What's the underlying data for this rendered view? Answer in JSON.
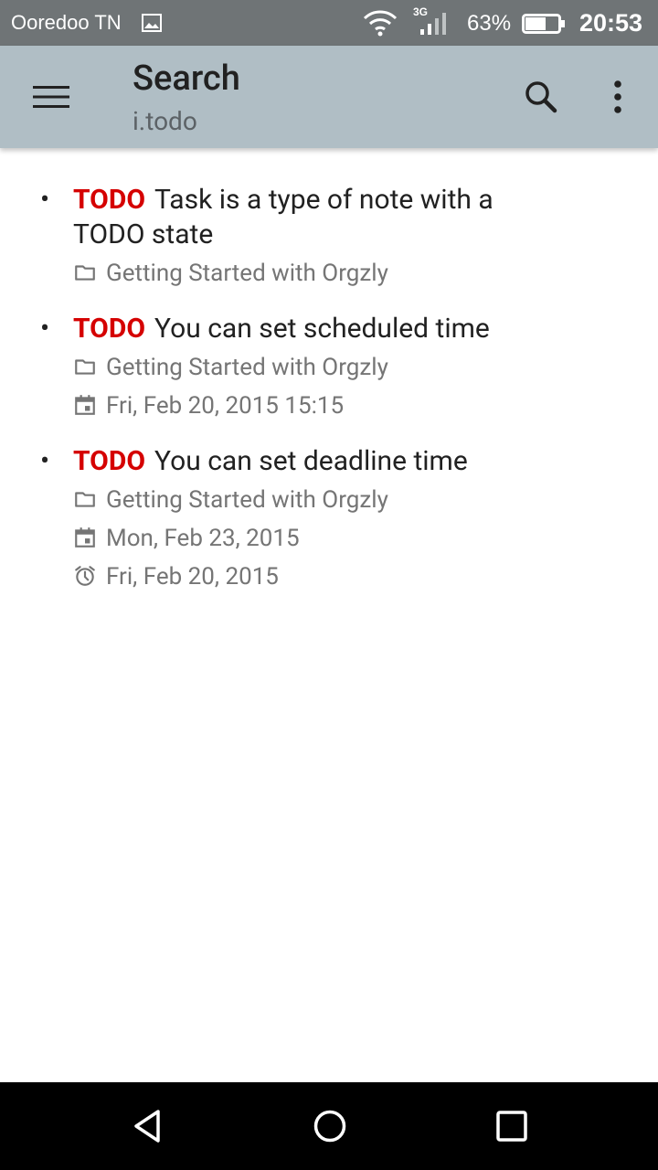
{
  "status_bar": {
    "carrier": "Ooredoo TN",
    "network_type": "3G",
    "battery_percent": "63%",
    "battery_level": 0.63,
    "time": "20:53"
  },
  "app_bar": {
    "title": "Search",
    "subtitle": "i.todo",
    "icons": [
      "menu-icon",
      "search-icon",
      "more-vert-icon"
    ]
  },
  "notes": [
    {
      "state": "TODO",
      "title": "Task is a type of note with a TODO state",
      "book": "Getting Started with Orgzly"
    },
    {
      "state": "TODO",
      "title": "You can set scheduled time",
      "book": "Getting Started with Orgzly",
      "scheduled": "Fri, Feb 20, 2015 15:15"
    },
    {
      "state": "TODO",
      "title": "You can set deadline time",
      "book": "Getting Started with Orgzly",
      "scheduled": "Mon, Feb 23, 2015",
      "deadline": "Fri, Feb 20, 2015"
    }
  ],
  "colors": {
    "status_bar": "#6f7476",
    "app_bar": "#b0bec5",
    "todo_state": "#d50000",
    "meta_text": "#757575"
  },
  "nav_bar": {
    "icons": [
      "back-icon",
      "home-icon",
      "recents-icon"
    ]
  }
}
